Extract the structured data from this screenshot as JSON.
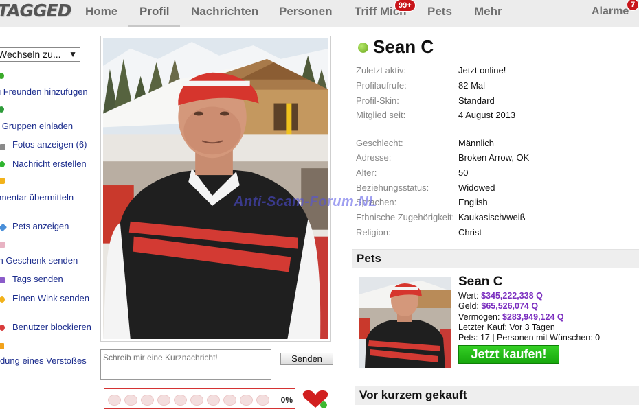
{
  "nav": {
    "logo": "TAGGED",
    "items": [
      "Home",
      "Profil",
      "Nachrichten",
      "Personen",
      "Triff Mich",
      "Pets",
      "Mehr"
    ],
    "meet_badge": "99+",
    "alerts_label": "Alarme",
    "alerts_badge": "7"
  },
  "sidebar": {
    "switch_label": "Wechseln zu...",
    "links": [
      "Zu Freunden hinzufügen",
      "Zu Gruppen einladen",
      "Fotos anzeigen (6)",
      "Nachricht erstellen",
      "Kommentar übermitteln",
      "Pets anzeigen",
      "Ein Geschenk senden",
      "Tags senden",
      "Einen Wink senden",
      "Benutzer blockieren",
      "Meldung eines Verstoßes"
    ]
  },
  "profile": {
    "name": "Sean C",
    "fields": [
      {
        "label": "Zuletzt aktiv:",
        "value": "Jetzt online!"
      },
      {
        "label": "Profilaufrufe:",
        "value": "82 Mal"
      },
      {
        "label": "Profil-Skin:",
        "value": "Standard"
      },
      {
        "label": "Mitglied seit:",
        "value": "4 August 2013"
      },
      {
        "label": "Geschlecht:",
        "value": "Männlich"
      },
      {
        "label": "Adresse:",
        "value": "Broken Arrow, OK"
      },
      {
        "label": "Alter:",
        "value": "50"
      },
      {
        "label": "Beziehungsstatus:",
        "value": "Widowed"
      },
      {
        "label": "Sprachen:",
        "value": "English"
      },
      {
        "label": "Ethnische Zugehörigkeit:",
        "value": "Kaukasisch/weiß"
      },
      {
        "label": "Religion:",
        "value": "Christ"
      }
    ],
    "watermark": "Anti-Scam-Forum.NL"
  },
  "message": {
    "placeholder": "Schreib mir eine Kurznachricht!",
    "send_label": "Senden",
    "hearts_percent": "0%"
  },
  "pets": {
    "title": "Pets",
    "name": "Sean C",
    "value_label": "Wert:",
    "value": "$345,222,338 Q",
    "cash_label": "Geld:",
    "cash": "$65,526,074 Q",
    "assets_label": "Vermögen:",
    "assets": "$283,949,124 Q",
    "last_buy": "Letzter Kauf: Vor 3 Tagen",
    "stats": "Pets: 17 | Personen mit Wünschen: 0",
    "buy_label": "Jetzt kaufen!"
  },
  "recent": {
    "title": "Vor kurzem gekauft"
  },
  "colors": {
    "link": "#1a2b8c",
    "price": "#7a2dbf",
    "buy_green": "#17a70d",
    "badge_red": "#c8151a"
  }
}
